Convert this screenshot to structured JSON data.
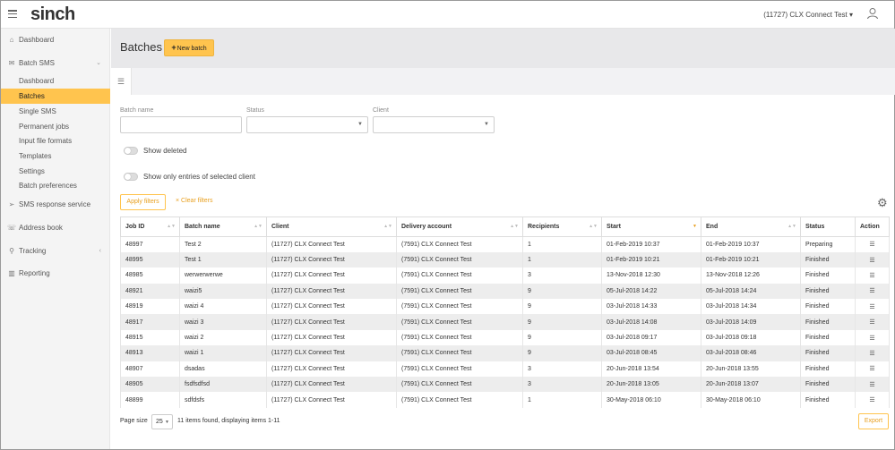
{
  "header": {
    "logo": "sinch",
    "account": "(11727) CLX Connect Test",
    "account_caret": "▾"
  },
  "sidebar": {
    "items": [
      {
        "label": "Dashboard",
        "icon": "home-icon"
      },
      {
        "label": "Batch SMS",
        "icon": "envelope-icon"
      },
      {
        "label": "SMS response service",
        "icon": "send-icon"
      },
      {
        "label": "Address book",
        "icon": "contacts-icon"
      },
      {
        "label": "Tracking",
        "icon": "search-icon"
      },
      {
        "label": "Reporting",
        "icon": "bar-chart-icon"
      }
    ],
    "batch_sub": [
      "Dashboard",
      "Batches",
      "Single SMS",
      "Permanent jobs",
      "Input file formats",
      "Templates",
      "Settings",
      "Batch preferences"
    ],
    "active_sub": "Batches"
  },
  "page": {
    "title": "Batches",
    "new_batch": "New batch",
    "new_batch_plus": "+"
  },
  "filters": {
    "batch_name_label": "Batch name",
    "status_label": "Status",
    "client_label": "Client",
    "show_deleted": "Show deleted",
    "show_only_selected": "Show only entries of selected client",
    "apply": "Apply filters",
    "clear": "Clear filters",
    "clear_icon": "×"
  },
  "table": {
    "columns": [
      "Job ID",
      "Batch name",
      "Client",
      "Delivery account",
      "Recipients",
      "Start",
      "End",
      "Status",
      "Action"
    ],
    "rows": [
      [
        "48997",
        "Test 2",
        "(11727) CLX Connect Test",
        "(7591) CLX Connect Test",
        "1",
        "01-Feb-2019 10:37",
        "01-Feb-2019 10:37",
        "Preparing"
      ],
      [
        "48995",
        "Test 1",
        "(11727) CLX Connect Test",
        "(7591) CLX Connect Test",
        "1",
        "01-Feb-2019 10:21",
        "01-Feb-2019 10:21",
        "Finished"
      ],
      [
        "48985",
        "werwerwerwe",
        "(11727) CLX Connect Test",
        "(7591) CLX Connect Test",
        "3",
        "13-Nov-2018 12:30",
        "13-Nov-2018 12:26",
        "Finished"
      ],
      [
        "48921",
        "waizi5",
        "(11727) CLX Connect Test",
        "(7591) CLX Connect Test",
        "9",
        "05-Jul-2018 14:22",
        "05-Jul-2018 14:24",
        "Finished"
      ],
      [
        "48919",
        "waizi 4",
        "(11727) CLX Connect Test",
        "(7591) CLX Connect Test",
        "9",
        "03-Jul-2018 14:33",
        "03-Jul-2018 14:34",
        "Finished"
      ],
      [
        "48917",
        "waizi 3",
        "(11727) CLX Connect Test",
        "(7591) CLX Connect Test",
        "9",
        "03-Jul-2018 14:08",
        "03-Jul-2018 14:09",
        "Finished"
      ],
      [
        "48915",
        "waizi 2",
        "(11727) CLX Connect Test",
        "(7591) CLX Connect Test",
        "9",
        "03-Jul-2018 09:17",
        "03-Jul-2018 09:18",
        "Finished"
      ],
      [
        "48913",
        "waizi 1",
        "(11727) CLX Connect Test",
        "(7591) CLX Connect Test",
        "9",
        "03-Jul-2018 08:45",
        "03-Jul-2018 08:46",
        "Finished"
      ],
      [
        "48907",
        "dsadas",
        "(11727) CLX Connect Test",
        "(7591) CLX Connect Test",
        "3",
        "20-Jun-2018 13:54",
        "20-Jun-2018 13:55",
        "Finished"
      ],
      [
        "48905",
        "fsdfsdfsd",
        "(11727) CLX Connect Test",
        "(7591) CLX Connect Test",
        "3",
        "20-Jun-2018 13:05",
        "20-Jun-2018 13:07",
        "Finished"
      ],
      [
        "48899",
        "sdfdsfs",
        "(11727) CLX Connect Test",
        "(7591) CLX Connect Test",
        "1",
        "30-May-2018 06:10",
        "30-May-2018 06:10",
        "Finished"
      ]
    ],
    "action_icon": "list-icon",
    "sorted_column": "Start"
  },
  "pager": {
    "label": "Page size",
    "size": "25",
    "info": "11 items found, displaying items 1-11",
    "export": "Export"
  }
}
